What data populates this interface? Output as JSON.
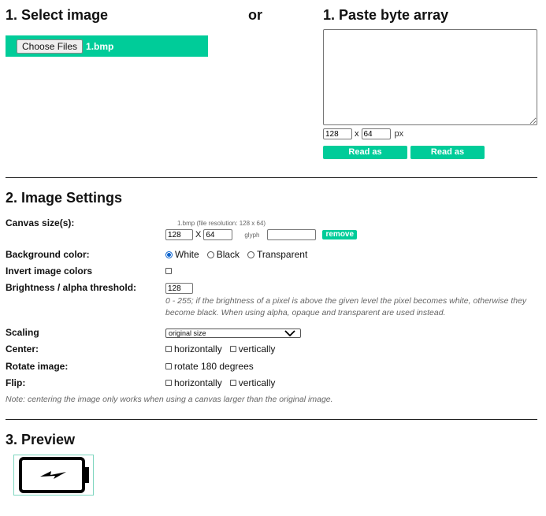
{
  "section1": {
    "title_left": "1. Select image",
    "or_text": "or",
    "title_right": "1. Paste byte array",
    "choose_files_label": "Choose Files",
    "file_name": "1.bmp",
    "paste_width": "128",
    "paste_x": "x",
    "paste_height": "64",
    "paste_unit": "px",
    "read_horizontal_label": "Read as horizontal",
    "read_vertical_label": "Read as vertical"
  },
  "section2": {
    "title": "2. Image Settings",
    "canvas_label": "Canvas size(s):",
    "canvas_file_info": "1.bmp  (file resolution: 128 x 64)",
    "canvas_width": "128",
    "canvas_x": "X",
    "canvas_height": "64",
    "glyph_label": "glyph",
    "glyph_value": "",
    "remove_label": "remove",
    "bg_label": "Background color:",
    "bg_options": [
      "White",
      "Black",
      "Transparent"
    ],
    "bg_selected": "White",
    "invert_label": "Invert image colors",
    "threshold_label": "Brightness / alpha threshold:",
    "threshold_value": "128",
    "threshold_note": "0 - 255; if the brightness of a pixel is above the given level the pixel becomes white, otherwise they become black. When using alpha, opaque and transparent are used instead.",
    "scaling_label": "Scaling",
    "scaling_value": "original size",
    "center_label": "Center:",
    "center_h": "horizontally",
    "center_v": "vertically",
    "rotate_label": "Rotate image:",
    "rotate_option": "rotate 180 degrees",
    "flip_label": "Flip:",
    "flip_h": "horizontally",
    "flip_v": "vertically",
    "bottom_note": "Note: centering the image only works when using a canvas larger than the original image."
  },
  "section3": {
    "title": "3. Preview",
    "preview_icon": "battery-charging-icon"
  },
  "colors": {
    "accent": "#00cc99",
    "radio_accent": "#0b63ce"
  }
}
